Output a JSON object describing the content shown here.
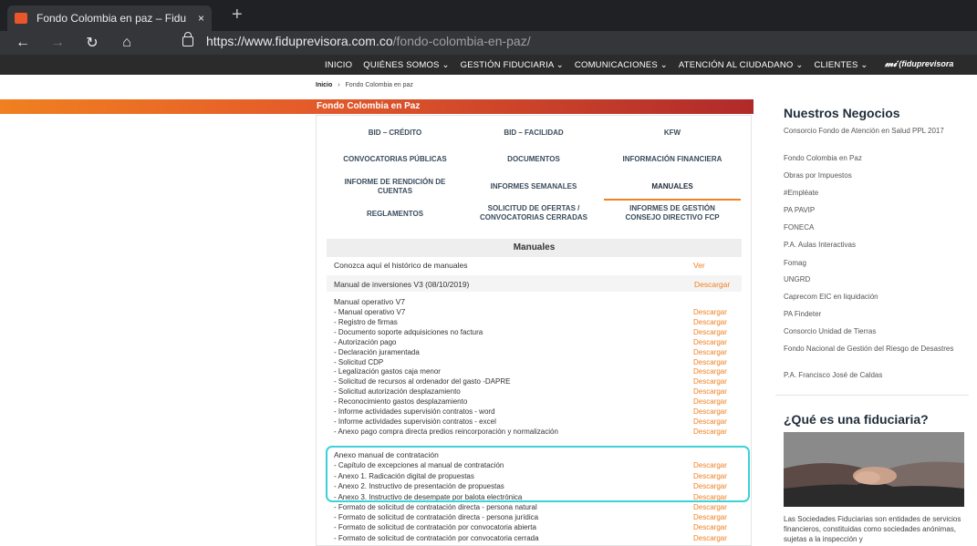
{
  "browser": {
    "tab_title": "Fondo Colombia en paz – Fidu",
    "tab_close": "×",
    "new_tab": "+",
    "url_host": "https://www.fiduprevisora.com.co",
    "url_path": "/fondo-colombia-en-paz/"
  },
  "site_nav": {
    "items": [
      "INICIO",
      "QUIÉNES SOMOS ⌄",
      "GESTIÓN FIDUCIARIA ⌄",
      "COMUNICACIONES ⌄",
      "ATENCIÓN AL CIUDADANO ⌄",
      "CLIENTES ⌄"
    ],
    "logo": "(fiduprevisora"
  },
  "breadcrumb": {
    "home": "Inicio",
    "sep": "›",
    "current": "Fondo Colombia en paz"
  },
  "section_title": "Fondo Colombia en Paz",
  "tabs": [
    "BID – CRÉDITO",
    "BID – FACILIDAD",
    "KFW",
    "CONVOCATORIAS PÚBLICAS",
    "DOCUMENTOS",
    "INFORMACIÓN FINANCIERA",
    "INFORME DE RENDICIÓN DE CUENTAS",
    "INFORMES SEMANALES",
    "MANUALES",
    "REGLAMENTOS",
    "SOLICITUD DE OFERTAS / CONVOCATORIAS CERRADAS",
    "INFORMES DE GESTIÓN CONSEJO DIRECTIVO FCP"
  ],
  "manuals": {
    "heading": "Manuales",
    "historic": {
      "label": "Conozca aquí el histórico de manuales",
      "action": "Ver"
    },
    "inversiones": {
      "label": "Manual de inversiones V3 (08/10/2019)",
      "action": "Descargar"
    },
    "operativo_title": "Manual operativo V7",
    "operativo_items": [
      "- Manual operativo V7",
      "- Registro de firmas",
      "- Documento soporte adquisiciones no factura",
      "- Autorización pago",
      "- Declaración juramentada",
      "- Solicitud CDP",
      "- Legalización gastos caja menor",
      "- Solicitud de recursos al ordenador del gasto -DAPRE",
      "- Solicitud autorización desplazamiento",
      "- Reconocimiento gastos desplazamiento",
      "- Informe actividades supervisión contratos - word",
      "- Informe actividades supervisión contratos - excel",
      "- Anexo pago compra directa predios reincorporación y normalización"
    ],
    "anexo_title": "Anexo manual de contratación",
    "anexo_items": [
      "- Capítulo de excepciones al manual de contratación",
      "- Anexo 1. Radicación digital de propuestas",
      "- Anexo 2. Instructivo de presentación de propuestas",
      "- Anexo 3. Instructivo de desempate por balota electrónica"
    ],
    "formato_items": [
      "- Formato de solicitud de contratación directa - persona natural",
      "- Formato de solicitud de contratación directa - persona jurídica",
      "- Formato de solicitud de contratación por convocatoria abierta",
      "- Formato de solicitud de contratación por convocatoria cerrada"
    ],
    "download_label": "Descargar"
  },
  "sidebar": {
    "heading": "Nuestros Negocios",
    "items": [
      "Consorcio Fondo de Atención en Salud PPL 2017",
      "Fondo Colombia en Paz",
      "Obras por Impuestos",
      "#Empléate",
      "PA PAVIP",
      "FONECA",
      "P.A. Aulas Interactivas",
      "Fomag",
      "UNGRD",
      "Caprecom EIC en liquidación",
      "PA Findeter",
      "Consorcio Unidad de Tierras",
      "Fondo Nacional de Gestión del Riesgo de Desastres",
      "P.A. Francisco José de Caldas"
    ],
    "fiduciaria_heading": "¿Qué es una fiduciaria?",
    "fiduciaria_text": "Las Sociedades Fiduciarias son entidades de servicios financieros, constituidas como sociedades anónimas, sujetas a la inspección y"
  }
}
